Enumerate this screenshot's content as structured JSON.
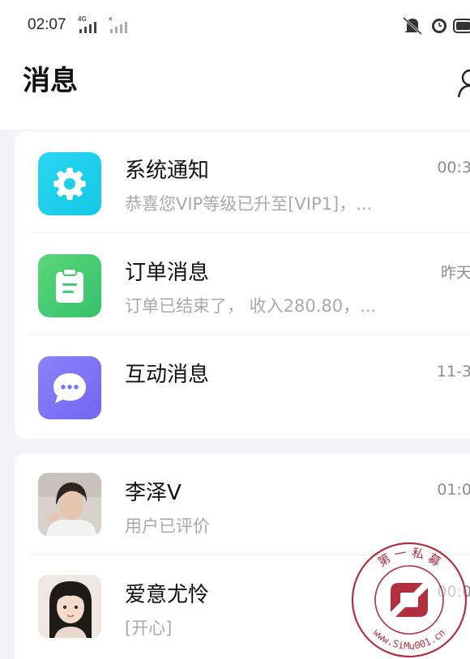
{
  "status_bar": {
    "time": "02:07",
    "signal1_label": "4G",
    "signal2_label": "×"
  },
  "header": {
    "title": "消息"
  },
  "system_messages": [
    {
      "title": "系统通知",
      "subtitle": "恭喜您VIP等级已升至[VIP1]，...",
      "time": "00:3",
      "icon": "gear-icon"
    },
    {
      "title": "订单消息",
      "subtitle": "订单已结束了， 收入280.80，...",
      "time": "昨天",
      "icon": "clipboard-icon"
    },
    {
      "title": "互动消息",
      "subtitle": "",
      "time": "11-3",
      "icon": "chat-bubble-icon"
    }
  ],
  "chats": [
    {
      "name": "李泽V",
      "preview": "用户已评价",
      "time": "01:0"
    },
    {
      "name": "爱意尤怜",
      "preview": "[开心]",
      "time": "00:0"
    }
  ],
  "watermark": {
    "top_text": "第 一 私 募",
    "bottom_text": "www.SiMu001.cn"
  },
  "colors": {
    "gear_icon_bg": "#1ecfec",
    "clipboard_icon_bg": "#45cc72",
    "bubble_icon_bg": "#7d74f6",
    "watermark": "#b03040"
  }
}
